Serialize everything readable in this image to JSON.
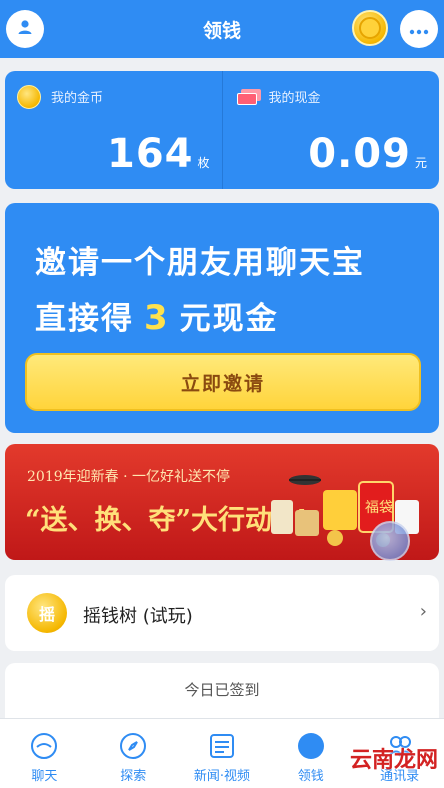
{
  "header": {
    "title": "领钱",
    "left_icon": "user-icon",
    "right_icon": "more-icon",
    "coin_icon": "coin-icon"
  },
  "balance": {
    "gold": {
      "label": "我的金币",
      "value": "164",
      "unit": "枚"
    },
    "cash": {
      "label": "我的现金",
      "value": "0.09",
      "unit": "元"
    }
  },
  "invite": {
    "line1": "邀请一个朋友用聊天宝",
    "line2_prefix": "直接得",
    "line2_amount": "3",
    "line2_suffix": "元现金",
    "button_label": "立即邀请"
  },
  "banner": {
    "subtitle": "2019年迎新春 · 一亿好礼送不停",
    "headline": "“送、换、夺”大行动!!!"
  },
  "money_tree": {
    "icon_char": "摇",
    "label": "摇钱树 (试玩)"
  },
  "sign_in": {
    "status": "今日已签到"
  },
  "nav": {
    "items": [
      {
        "label": "聊天",
        "icon": "chat-icon"
      },
      {
        "label": "探索",
        "icon": "compass-icon"
      },
      {
        "label": "新闻·视频",
        "icon": "news-icon"
      },
      {
        "label": "领钱",
        "icon": "money-icon"
      },
      {
        "label": "通讯录",
        "icon": "contacts-icon"
      }
    ]
  },
  "watermark": "云南龙网",
  "colors": {
    "primary": "#2f8cf3",
    "accent_yellow": "#ffe14d",
    "banner_red": "#d42a20"
  }
}
